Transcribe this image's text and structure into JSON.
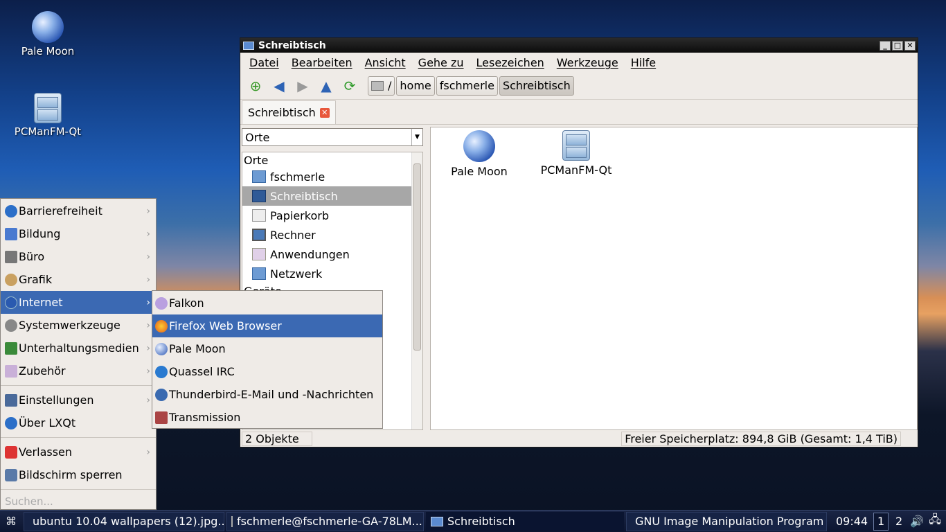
{
  "desktop": {
    "icons": [
      {
        "label": "Pale Moon",
        "icon": "pale-moon-icon"
      },
      {
        "label": "PCManFM-Qt",
        "icon": "file-cabinet-icon"
      }
    ]
  },
  "window": {
    "title": "Schreibtisch",
    "menu": [
      "Datei",
      "Bearbeiten",
      "Ansicht",
      "Gehe zu",
      "Lesezeichen",
      "Werkzeuge",
      "Hilfe"
    ],
    "path": {
      "root": "/",
      "segments": [
        "home",
        "fschmerle",
        "Schreibtisch"
      ]
    },
    "tab_label": "Schreibtisch",
    "side_selector": "Orte",
    "places_header": "Orte",
    "places": [
      "fschmerle",
      "Schreibtisch",
      "Papierkorb",
      "Rechner",
      "Anwendungen",
      "Netzwerk"
    ],
    "devices_header": "Geräte",
    "files": [
      "Pale Moon",
      "PCManFM-Qt"
    ],
    "status_left": "2 Objekte",
    "status_right": "Freier Speicherplatz: 894,8 GiB (Gesamt: 1,4 TiB)"
  },
  "start_menu": {
    "items": [
      "Barrierefreiheit",
      "Bildung",
      "Büro",
      "Grafik",
      "Internet",
      "Systemwerkzeuge",
      "Unterhaltungsmedien",
      "Zubehör"
    ],
    "items2": [
      "Einstellungen",
      "Über LXQt"
    ],
    "items3": [
      "Verlassen",
      "Bildschirm sperren"
    ],
    "search_placeholder": "Suchen..."
  },
  "internet_submenu": [
    "Falkon",
    "Firefox Web Browser",
    "Pale Moon",
    "Quassel IRC",
    "Thunderbird-E-Mail und -Nachrichten",
    "Transmission"
  ],
  "taskbar": {
    "tasks": [
      "ubuntu 10.04 wallpapers (12).jpg...",
      "fschmerle@fschmerle-GA-78LM...",
      "Schreibtisch",
      "GNU Image Manipulation Program"
    ],
    "clock": "09:44",
    "workspaces": [
      "1",
      "2"
    ]
  },
  "colors": {
    "highlight": "#3b69b3",
    "window_bg": "#efebe7",
    "taskbar": "#0c1530"
  }
}
